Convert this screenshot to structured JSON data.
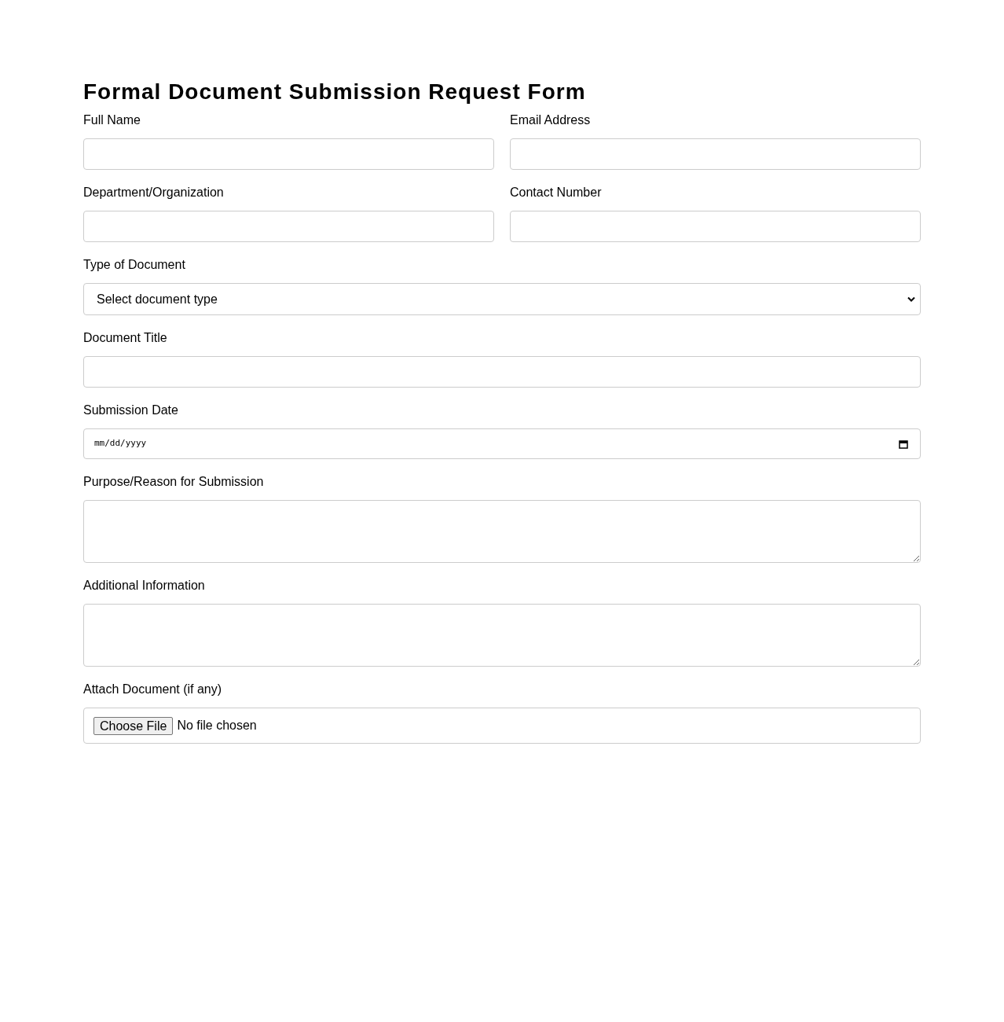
{
  "title": "Formal Document Submission Request Form",
  "rows": [
    [
      {
        "kind": "text",
        "label": "Full Name"
      },
      {
        "kind": "text",
        "label": "Email Address"
      }
    ],
    [
      {
        "kind": "text",
        "label": "Department/Organization"
      },
      {
        "kind": "text",
        "label": "Contact Number"
      }
    ],
    [
      {
        "kind": "select",
        "label": "Type of Document",
        "value": "Select document type"
      }
    ],
    [
      {
        "kind": "text",
        "label": "Document Title"
      }
    ],
    [
      {
        "kind": "date",
        "label": "Submission Date",
        "placeholder": "mm/dd/yyyy"
      }
    ],
    [
      {
        "kind": "textarea",
        "label": "Purpose/Reason for Submission"
      }
    ],
    [
      {
        "kind": "textarea",
        "label": "Additional Information"
      }
    ],
    [
      {
        "kind": "file",
        "label": "Attach Document (if any)",
        "button_label": "Choose File",
        "status": "No file chosen"
      }
    ]
  ]
}
